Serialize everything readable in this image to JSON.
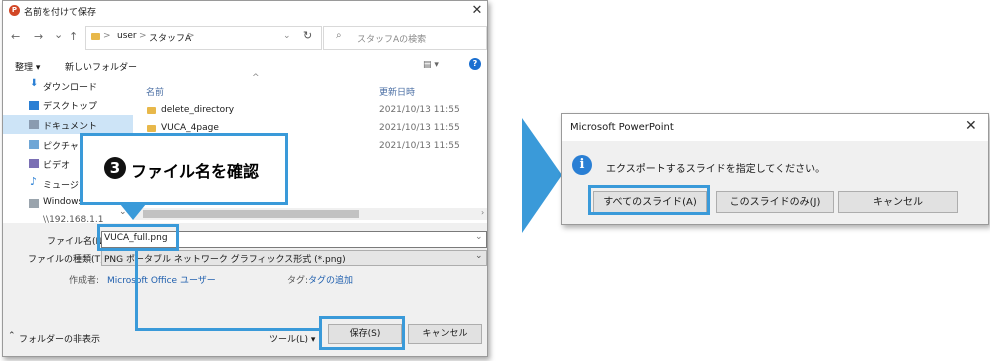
{
  "save_dialog": {
    "title": "名前を付けて保存",
    "app_icon_letter": "P",
    "nav": {
      "back": "←",
      "forward": "→",
      "dropdown": "⌄",
      "up": "↑",
      "refresh": "↻"
    },
    "breadcrumb": [
      "user",
      "スタッフA"
    ],
    "breadcrumb_sep": ">",
    "search_placeholder": "スタッフAの検索",
    "toolbar": {
      "organize": "整理 ▾",
      "new_folder": "新しいフォルダー",
      "view": "▤ ▾"
    },
    "help": "?",
    "nav_items": [
      "ダウンロード",
      "デスクトップ",
      "ドキュメント",
      "ピクチャ",
      "ビデオ",
      "ミュージック",
      "Windows (C:)",
      "\\\\192.168.1.1"
    ],
    "columns": {
      "name": "名前",
      "date": "更新日時"
    },
    "files": [
      {
        "name": "delete_directory",
        "date": "2021/10/13 11:55"
      },
      {
        "name": "VUCA_4page",
        "date": "2021/10/13 11:55"
      },
      {
        "name": "",
        "date": "2021/10/13 11:55"
      }
    ],
    "filename_label": "ファイル名(N):",
    "filename_value": "VUCA_full.png",
    "filetype_label": "ファイルの種類(T):",
    "filetype_value": "PNG ポータブル ネットワーク グラフィックス形式 (*.png)",
    "author_label": "作成者:",
    "author_value": "Microsoft Office ユーザー",
    "tags_label": "タグ:",
    "tags_value": "タグの追加",
    "hide_folders": "フォルダーの非表示",
    "tools_label": "ツール(L) ▾",
    "save_button": "保存(S)",
    "cancel_button": "キャンセル"
  },
  "callout": {
    "number": "3",
    "text": "ファイル名を確認"
  },
  "powerpoint_dialog": {
    "title": "Microsoft PowerPoint",
    "close": "✕",
    "message": "エクスポートするスライドを指定してください。",
    "info_icon": "i",
    "buttons": {
      "all_slides": "すべてのスライド(A)",
      "this_slide": "このスライドのみ(J)",
      "cancel": "キャンセル"
    }
  },
  "colors": {
    "annotation_blue": "#3a9ad9",
    "link_blue": "#1f5fae",
    "selection": "#cde4f7"
  }
}
